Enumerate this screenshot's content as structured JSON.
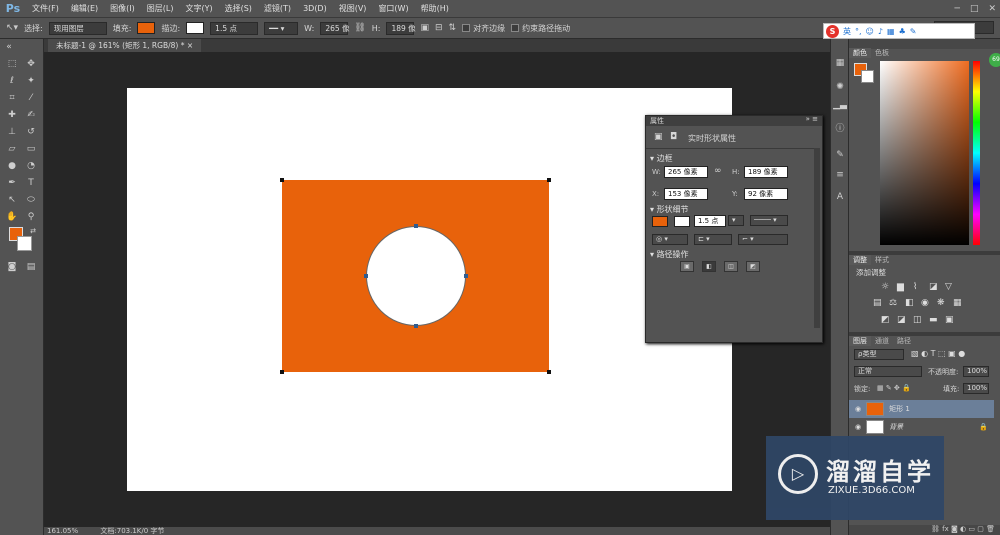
{
  "app": {
    "logo": "Ps"
  },
  "menu": [
    "文件(F)",
    "编辑(E)",
    "图像(I)",
    "图层(L)",
    "文字(Y)",
    "选择(S)",
    "滤镜(T)",
    "3D(D)",
    "视图(V)",
    "窗口(W)",
    "帮助(H)"
  ],
  "window_controls": [
    "─",
    "□",
    "✕"
  ],
  "options": {
    "select_label": "选择:",
    "select_value": "现用图层",
    "fill_label": "填充:",
    "stroke_label": "描边:",
    "stroke_width": "1.5 点",
    "w_label": "W:",
    "w_value": "265 像",
    "h_label": "H:",
    "h_value": "189 像",
    "align_edges": "对齐边缘",
    "constrain_path": "约束路径拖动",
    "fill_color": "#e8620b"
  },
  "workspace": {
    "name": "基本功能"
  },
  "ime": {
    "logo": "S",
    "lang": "英"
  },
  "doc_tab": {
    "title": "未标题-1 @ 161% (矩形 1, RGB/8) *",
    "close": "×"
  },
  "status": {
    "zoom": "161.05%",
    "info": "文档:703.1K/0 字节"
  },
  "properties": {
    "title": "属性",
    "subtitle": "实时形状属性",
    "section_bounds": "边框",
    "w_label": "W:",
    "w_value": "265 像素",
    "h_label": "H:",
    "h_value": "189 像素",
    "x_label": "X:",
    "x_value": "153 像素",
    "y_label": "Y:",
    "y_value": "92 像素",
    "section_shape": "形状细节",
    "stroke_width": "1.5 点",
    "section_path": "路径操作"
  },
  "color_panel": {
    "tabs": [
      "颜色",
      "色板"
    ],
    "fg": "#e8620b",
    "bg": "#ffffff",
    "badge": "69"
  },
  "adjust_panel": {
    "tabs": [
      "调整",
      "样式"
    ],
    "add_label": "添加调整"
  },
  "layers_panel": {
    "tabs": [
      "图层",
      "通道",
      "路径"
    ],
    "kind_label": "ρ类型",
    "blend_mode": "正常",
    "opacity_label": "不透明度:",
    "opacity_value": "100%",
    "lock_label": "锁定:",
    "fill_label": "填充:",
    "fill_value": "100%",
    "layers": [
      {
        "name": "矩形 1"
      },
      {
        "name": "背景"
      }
    ]
  },
  "watermark": {
    "cn": "溜溜自学",
    "url": "ZIXUE.3D66.COM"
  }
}
